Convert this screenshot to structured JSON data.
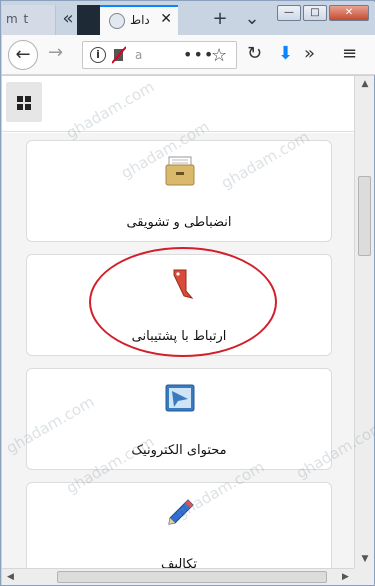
{
  "tabs": {
    "partial_title": "m t",
    "active_title": "داط",
    "new_tab_symbol": "+",
    "list_all_symbol": "⌄",
    "prev_symbol": "«",
    "close_symbol": "✕"
  },
  "window_controls": {
    "minimize": "—",
    "maximize": "□",
    "close": "✕"
  },
  "navbar": {
    "back_symbol": "←",
    "forward_symbol": "→",
    "url_text": "a",
    "page_actions_symbol": "•••",
    "bookmark_symbol": "☆",
    "reload_symbol": "↻",
    "download_symbol": "⬇",
    "overflow_symbol": "»",
    "menu_symbol": "≡"
  },
  "menu": {
    "cards": [
      {
        "label": "انضباطی و تشویقی",
        "icon": "archive-box-icon"
      },
      {
        "label": "ارتباط با پشتیبانی",
        "icon": "red-bookmark-tag-icon"
      },
      {
        "label": "محتوای الکترونیک",
        "icon": "monitor-icon"
      },
      {
        "label": "تکالیف",
        "icon": "pencil-icon"
      }
    ]
  },
  "watermark": "ghadam.com",
  "colors": {
    "accent_tab": "#0a84ff",
    "annotation": "#d21f2b",
    "download": "#0a84ff"
  }
}
